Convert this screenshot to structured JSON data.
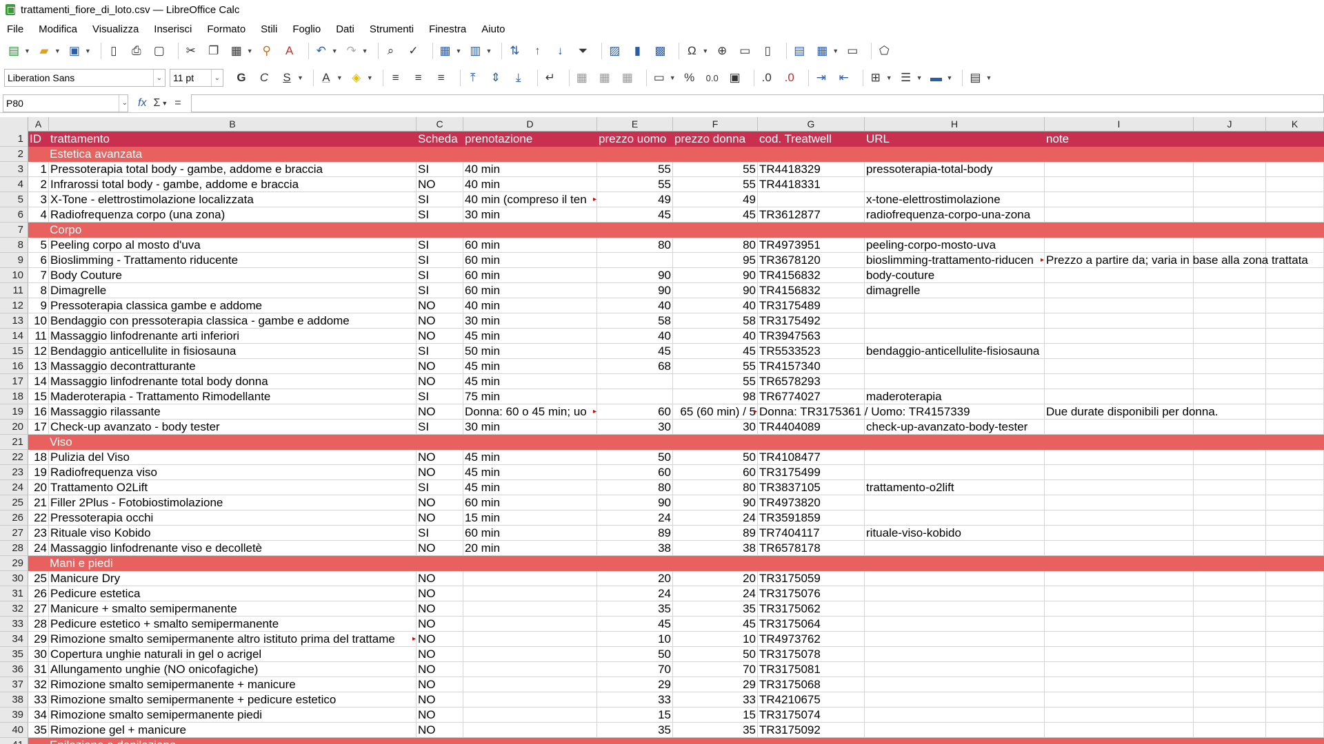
{
  "window": {
    "title": "trattamenti_fiore_di_loto.csv — LibreOffice Calc"
  },
  "menu": [
    "File",
    "Modifica",
    "Visualizza",
    "Inserisci",
    "Formato",
    "Stili",
    "Foglio",
    "Dati",
    "Strumenti",
    "Finestra",
    "Aiuto"
  ],
  "toolbar": {
    "font_name": "Liberation Sans",
    "font_size": "11 pt",
    "bold": "G",
    "italic": "C",
    "underline": "S",
    "percent": "%",
    "decimal": "0.0"
  },
  "formula_bar": {
    "name_box": "P80",
    "fx": "fx",
    "sigma": "Σ",
    "equals": "=",
    "content": ""
  },
  "columns": [
    "A",
    "B",
    "C",
    "D",
    "E",
    "F",
    "G",
    "H",
    "I",
    "J",
    "K"
  ],
  "rows": [
    {
      "n": "1",
      "type": "header",
      "cells": [
        "ID",
        "trattamento",
        "Scheda",
        "prenotazione",
        "prezzo uomo",
        "prezzo donna",
        "cod. Treatwell",
        "URL",
        "note",
        "",
        ""
      ]
    },
    {
      "n": "2",
      "type": "section",
      "label": "Estetica avanzata"
    },
    {
      "n": "3",
      "cells": [
        "1",
        "Pressoterapia total body - gambe, addome e braccia",
        "SI",
        "40 min",
        "55",
        "55",
        "TR4418329",
        "pressoterapia-total-body",
        "",
        "",
        ""
      ]
    },
    {
      "n": "4",
      "cells": [
        "2",
        "Infrarossi total body - gambe, addome e braccia",
        "NO",
        "40 min",
        "55",
        "55",
        "TR4418331",
        "",
        "",
        "",
        ""
      ]
    },
    {
      "n": "5",
      "cells": [
        "3",
        "X-Tone - elettrostimolazione localizzata",
        "SI",
        "40 min (compreso il ten",
        "49",
        "49",
        "",
        "x-tone-elettrostimolazione",
        "",
        "",
        ""
      ]
    },
    {
      "n": "6",
      "cells": [
        "4",
        "Radiofrequenza corpo (una zona)",
        "SI",
        "30 min",
        "45",
        "45",
        "TR3612877",
        "radiofrequenza-corpo-una-zona",
        "",
        "",
        ""
      ]
    },
    {
      "n": "7",
      "type": "section",
      "label": "Corpo"
    },
    {
      "n": "8",
      "cells": [
        "5",
        "Peeling corpo al mosto d'uva",
        "SI",
        "60 min",
        "80",
        "80",
        "TR4973951",
        "peeling-corpo-mosto-uva",
        "",
        "",
        ""
      ]
    },
    {
      "n": "9",
      "cells": [
        "6",
        "Bioslimming - Trattamento riducente",
        "SI",
        "60 min",
        "",
        "95",
        "TR3678120",
        "bioslimming-trattamento-riducen",
        "Prezzo a partire da; varia in base alla zona trattata",
        "",
        ""
      ]
    },
    {
      "n": "10",
      "cells": [
        "7",
        "Body Couture",
        "SI",
        "60 min",
        "90",
        "90",
        "TR4156832",
        "body-couture",
        "",
        "",
        ""
      ]
    },
    {
      "n": "11",
      "cells": [
        "8",
        "Dimagrelle",
        "SI",
        "60 min",
        "90",
        "90",
        "TR4156832",
        "dimagrelle",
        "",
        "",
        ""
      ]
    },
    {
      "n": "12",
      "cells": [
        "9",
        "Pressoterapia classica gambe e addome",
        "NO",
        "40 min",
        "40",
        "40",
        "TR3175489",
        "",
        "",
        "",
        ""
      ]
    },
    {
      "n": "13",
      "cells": [
        "10",
        "Bendaggio con pressoterapia classica - gambe e addome",
        "NO",
        "30 min",
        "58",
        "58",
        "TR3175492",
        "",
        "",
        "",
        ""
      ]
    },
    {
      "n": "14",
      "cells": [
        "11",
        "Massaggio linfodrenante arti inferiori",
        "NO",
        "45 min",
        "40",
        "40",
        "TR3947563",
        "",
        "",
        "",
        ""
      ]
    },
    {
      "n": "15",
      "cells": [
        "12",
        "Bendaggio anticellulite in fisiosauna",
        "SI",
        "50 min",
        "45",
        "45",
        "TR5533523",
        "bendaggio-anticellulite-fisiosauna",
        "",
        "",
        ""
      ]
    },
    {
      "n": "16",
      "cells": [
        "13",
        "Massaggio decontratturante",
        "NO",
        "45 min",
        "68",
        "55",
        "TR4157340",
        "",
        "",
        "",
        ""
      ]
    },
    {
      "n": "17",
      "cells": [
        "14",
        "Massaggio linfodrenante total body donna",
        "NO",
        "45 min",
        "",
        "55",
        "TR6578293",
        "",
        "",
        "",
        ""
      ]
    },
    {
      "n": "18",
      "cells": [
        "15",
        "Maderoterapia - Trattamento Rimodellante",
        "SI",
        "75 min",
        "",
        "98",
        "TR6774027",
        "maderoterapia",
        "",
        "",
        ""
      ]
    },
    {
      "n": "19",
      "cells": [
        "16",
        "Massaggio rilassante",
        "NO",
        "Donna: 60 o 45 min; uo",
        "60",
        "65 (60 min) / 5",
        "Donna: TR3175361 / Uomo: TR4157339",
        "",
        "Due durate disponibili per donna.",
        "",
        ""
      ]
    },
    {
      "n": "20",
      "cells": [
        "17",
        "Check-up avanzato - body tester",
        "SI",
        "30 min",
        "30",
        "30",
        "TR4404089",
        "check-up-avanzato-body-tester",
        "",
        "",
        ""
      ]
    },
    {
      "n": "21",
      "type": "section",
      "label": "Viso"
    },
    {
      "n": "22",
      "cells": [
        "18",
        "Pulizia del Viso",
        "NO",
        "45 min",
        "50",
        "50",
        "TR4108477",
        "",
        "",
        "",
        ""
      ]
    },
    {
      "n": "23",
      "cells": [
        "19",
        "Radiofrequenza viso",
        "NO",
        "45 min",
        "60",
        "60",
        "TR3175499",
        "",
        "",
        "",
        ""
      ]
    },
    {
      "n": "24",
      "cells": [
        "20",
        "Trattamento O2Lift",
        "SI",
        "45 min",
        "80",
        "80",
        "TR3837105",
        "trattamento-o2lift",
        "",
        "",
        ""
      ]
    },
    {
      "n": "25",
      "cells": [
        "21",
        "Filler 2Plus - Fotobiostimolazione",
        "NO",
        "60 min",
        "90",
        "90",
        "TR4973820",
        "",
        "",
        "",
        ""
      ]
    },
    {
      "n": "26",
      "cells": [
        "22",
        "Pressoterapia occhi",
        "NO",
        "15 min",
        "24",
        "24",
        "TR3591859",
        "",
        "",
        "",
        ""
      ]
    },
    {
      "n": "27",
      "cells": [
        "23",
        "Rituale viso Kobido",
        "SI",
        "60 min",
        "89",
        "89",
        "TR7404117",
        "rituale-viso-kobido",
        "",
        "",
        ""
      ]
    },
    {
      "n": "28",
      "cells": [
        "24",
        "Massaggio linfodrenante viso e decolletè",
        "NO",
        "20 min",
        "38",
        "38",
        "TR6578178",
        "",
        "",
        "",
        ""
      ]
    },
    {
      "n": "29",
      "type": "section",
      "label": "Mani e piedi"
    },
    {
      "n": "30",
      "cells": [
        "25",
        "Manicure Dry",
        "NO",
        "",
        "20",
        "20",
        "TR3175059",
        "",
        "",
        "",
        ""
      ]
    },
    {
      "n": "31",
      "cells": [
        "26",
        "Pedicure estetica",
        "NO",
        "",
        "24",
        "24",
        "TR3175076",
        "",
        "",
        "",
        ""
      ]
    },
    {
      "n": "32",
      "cells": [
        "27",
        "Manicure + smalto semipermanente",
        "NO",
        "",
        "35",
        "35",
        "TR3175062",
        "",
        "",
        "",
        ""
      ]
    },
    {
      "n": "33",
      "cells": [
        "28",
        "Pedicure estetico + smalto semipermanente",
        "NO",
        "",
        "45",
        "45",
        "TR3175064",
        "",
        "",
        "",
        ""
      ]
    },
    {
      "n": "34",
      "cells": [
        "29",
        "Rimozione smalto semipermanente altro istituto prima del trattame",
        "NO",
        "",
        "10",
        "10",
        "TR4973762",
        "",
        "",
        "",
        ""
      ]
    },
    {
      "n": "35",
      "cells": [
        "30",
        "Copertura unghie naturali in gel o acrigel",
        "NO",
        "",
        "50",
        "50",
        "TR3175078",
        "",
        "",
        "",
        ""
      ]
    },
    {
      "n": "36",
      "cells": [
        "31",
        "Allungamento unghie (NO onicofagiche)",
        "NO",
        "",
        "70",
        "70",
        "TR3175081",
        "",
        "",
        "",
        ""
      ]
    },
    {
      "n": "37",
      "cells": [
        "32",
        "Rimozione smalto semipermanente + manicure",
        "NO",
        "",
        "29",
        "29",
        "TR3175068",
        "",
        "",
        "",
        ""
      ]
    },
    {
      "n": "38",
      "cells": [
        "33",
        "Rimozione smalto semipermanente + pedicure estetico",
        "NO",
        "",
        "33",
        "33",
        "TR4210675",
        "",
        "",
        "",
        ""
      ]
    },
    {
      "n": "39",
      "cells": [
        "34",
        "Rimozione smalto semipermanente piedi",
        "NO",
        "",
        "15",
        "15",
        "TR3175074",
        "",
        "",
        "",
        ""
      ]
    },
    {
      "n": "40",
      "cells": [
        "35",
        "Rimozione gel + manicure",
        "NO",
        "",
        "35",
        "35",
        "TR3175092",
        "",
        "",
        "",
        ""
      ]
    },
    {
      "n": "41",
      "type": "section",
      "label": "Epilazione e depilazione"
    }
  ],
  "colors": {
    "header_bg": "#c9304f",
    "section_bg": "#e8615e",
    "app_icon": "#3a9b3a"
  }
}
